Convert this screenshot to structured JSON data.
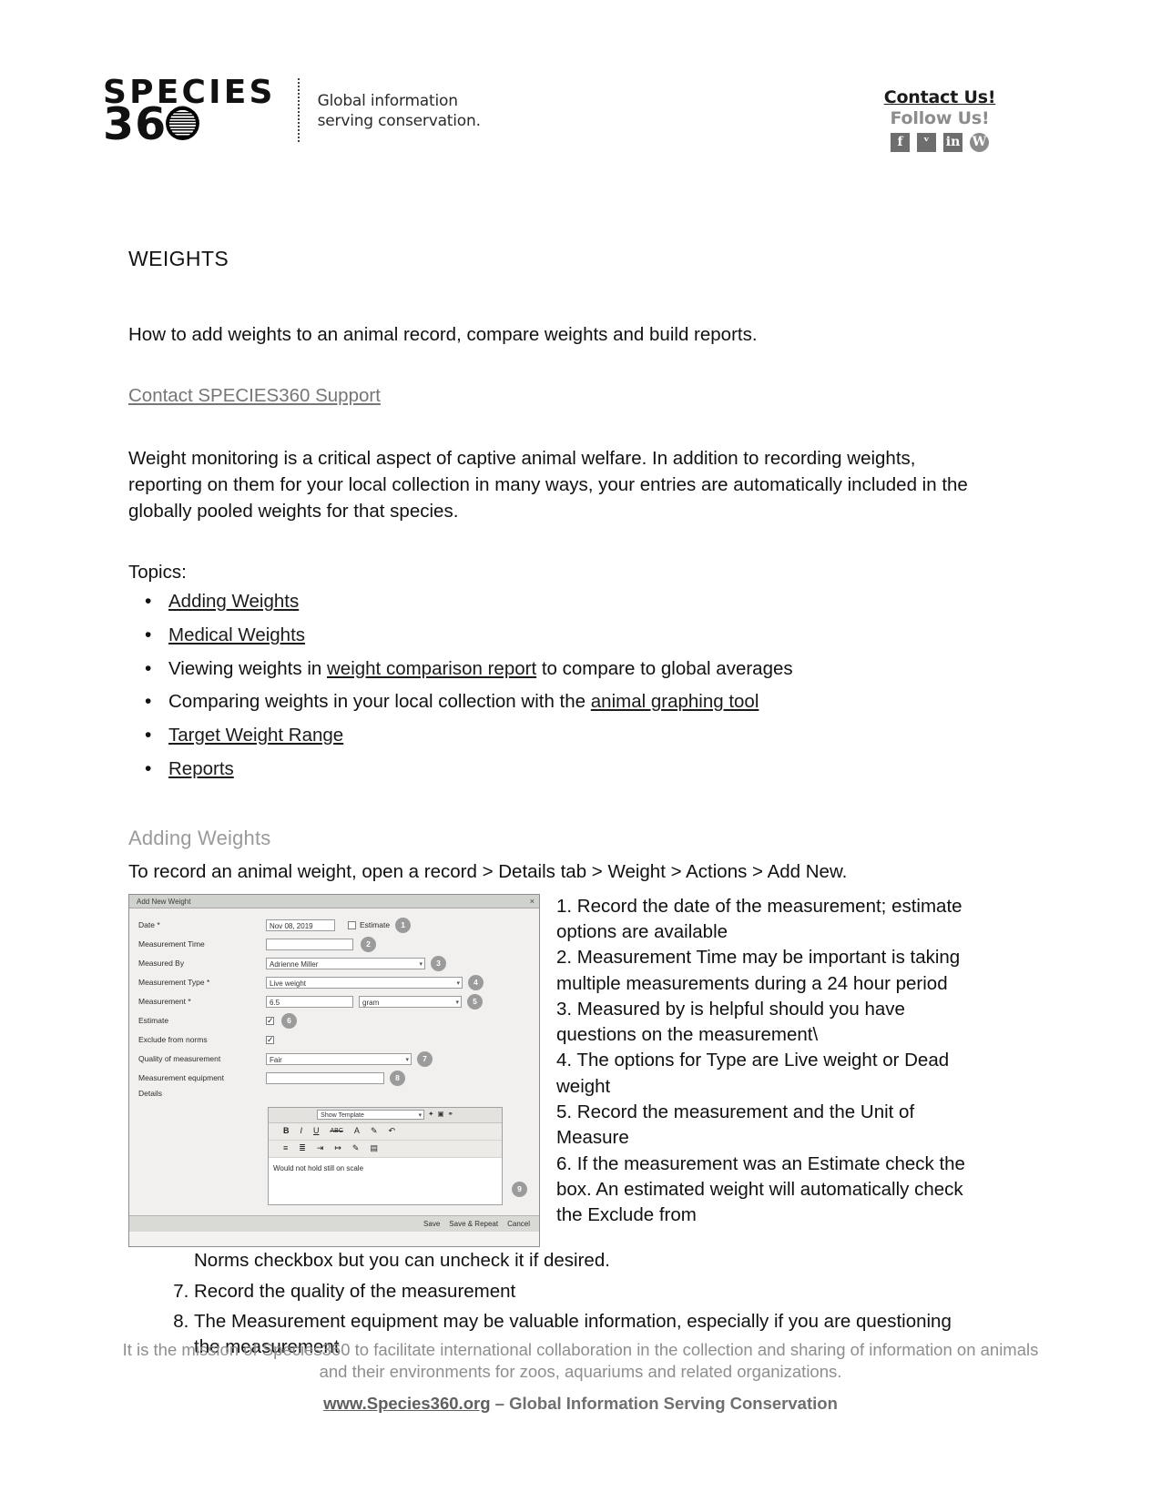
{
  "header": {
    "brand_species": "SPECIES",
    "brand_number": "360",
    "brand_tagline_line1": "Global information",
    "brand_tagline_line2": "serving conservation.",
    "contact_us": "Contact Us!",
    "follow_us": "Follow Us!",
    "social": [
      {
        "name": "facebook-icon",
        "glyph": "f"
      },
      {
        "name": "twitter-icon",
        "glyph": "ᵛ"
      },
      {
        "name": "linkedin-icon",
        "glyph": "in"
      },
      {
        "name": "wordpress-icon",
        "glyph": "W"
      }
    ]
  },
  "document": {
    "title": "WEIGHTS",
    "intro": "How to add weights to an animal record, compare weights and build reports.",
    "support_link": "Contact SPECIES360 Support",
    "paragraph": "Weight monitoring is a critical aspect of captive animal welfare. In addition to recording weights, reporting on them for your local collection in many ways, your entries are automatically included in the globally pooled weights for that species.",
    "topics_label": "Topics:",
    "topics": [
      {
        "prefix": "",
        "link": "Adding Weights",
        "suffix": ""
      },
      {
        "prefix": "",
        "link": "Medical Weights",
        "suffix": ""
      },
      {
        "prefix": "Viewing weights in ",
        "link": "weight comparison report",
        "suffix": " to compare to global averages"
      },
      {
        "prefix": "Comparing weights in your local collection with the ",
        "link": "animal graphing tool",
        "suffix": ""
      },
      {
        "prefix": "",
        "link": "Target Weight Range",
        "suffix": ""
      },
      {
        "prefix": "",
        "link": "Reports",
        "suffix": ""
      }
    ],
    "section_heading": "Adding Weights",
    "lead_line": "To record an animal weight, open a record > Details tab > Weight > Actions > Add New."
  },
  "dialog": {
    "title": "Add New Weight",
    "close_glyph": "×",
    "fields": {
      "date_label": "Date *",
      "date_value": "Nov 08, 2019",
      "estimate_inline_label": "Estimate",
      "measurement_time_label": "Measurement Time",
      "measurement_time_value": "",
      "measured_by_label": "Measured By",
      "measured_by_value": "Adrienne Miller",
      "measurement_type_label": "Measurement Type *",
      "measurement_type_value": "Live weight",
      "measurement_label": "Measurement *",
      "measurement_value": "6.5",
      "measurement_unit": "gram",
      "estimate_label": "Estimate",
      "exclude_label": "Exclude from norms",
      "quality_label": "Quality of measurement",
      "quality_value": "Fair",
      "equipment_label": "Measurement equipment",
      "equipment_value": "",
      "details_label": "Details"
    },
    "editor": {
      "style_select": "Show Template",
      "toolbar_row1": [
        "B",
        "I",
        "U",
        "ABC",
        "A",
        "✐",
        "↶"
      ],
      "toolbar_row2": [
        "≡",
        "≣",
        "⇥",
        "↦",
        "✎",
        "▤"
      ],
      "content": "Would not hold still on scale"
    },
    "footer_buttons": [
      "Save",
      "Save & Repeat",
      "Cancel"
    ],
    "callouts": [
      "1",
      "2",
      "3",
      "4",
      "5",
      "6",
      "7",
      "8",
      "9"
    ]
  },
  "steps": {
    "right_column": [
      "1.  Record the date of the measurement; estimate options are available",
      "2.  Measurement Time may be important is taking multiple measurements during a 24 hour period",
      "3.  Measured by is helpful should you have questions on the measurement\\",
      "4.  The options for Type are Live weight or Dead weight",
      "5.  Record the measurement and the Unit of Measure",
      "6.  If the measurement was an Estimate check the box. An estimated weight will automatically check the Exclude from"
    ],
    "spill_line": "Norms checkbox but you can uncheck it if desired.",
    "tail": [
      "Record the quality of the measurement",
      "The Measurement equipment may be valuable information, especially if you are questioning the measurement"
    ],
    "tail_start": 7
  },
  "footer": {
    "mission": "It is the mission of Species360 to facilitate international collaboration in the collection and sharing of information on animals and their environments for zoos, aquariums and related organizations.",
    "url": "www.Species360.org",
    "tagline_rest": " – Global Information Serving Conservation"
  }
}
